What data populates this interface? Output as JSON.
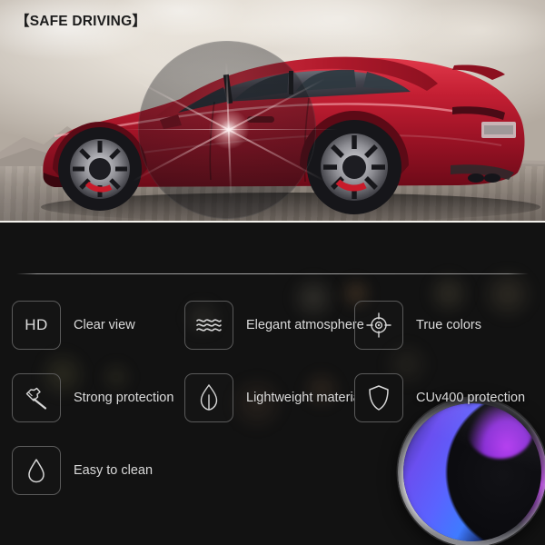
{
  "hero": {
    "title": "【SAFE DRIVING】",
    "scene_description": "red sports sedan side profile on hazy mountain road",
    "overlay": "tint-film-circle",
    "title_color": "#1d1d1d"
  },
  "features": {
    "divider": true,
    "accent_colors": {
      "text": "#dadada",
      "icon_border": "#5a5a5a",
      "background": "#121212",
      "lens_blue": "#3f7bff",
      "lens_violet": "#b43df0"
    },
    "items": [
      {
        "icon": "hd-icon",
        "icon_text": "HD",
        "label": "Clear view"
      },
      {
        "icon": "waves-icon",
        "icon_text": "",
        "label": "Elegant atmosphere"
      },
      {
        "icon": "crosshair-icon",
        "icon_text": "",
        "label": "True colors"
      },
      {
        "icon": "hammer-icon",
        "icon_text": "",
        "label": "Strong protection"
      },
      {
        "icon": "leaf-icon",
        "icon_text": "",
        "label": "Lightweight material"
      },
      {
        "icon": "shield-icon",
        "icon_text": "",
        "label": "CUv400 protection"
      },
      {
        "icon": "water-drop-icon",
        "icon_text": "",
        "label": "Easy to clean"
      }
    ]
  },
  "lens": {
    "name": "optical-lens-disc"
  }
}
